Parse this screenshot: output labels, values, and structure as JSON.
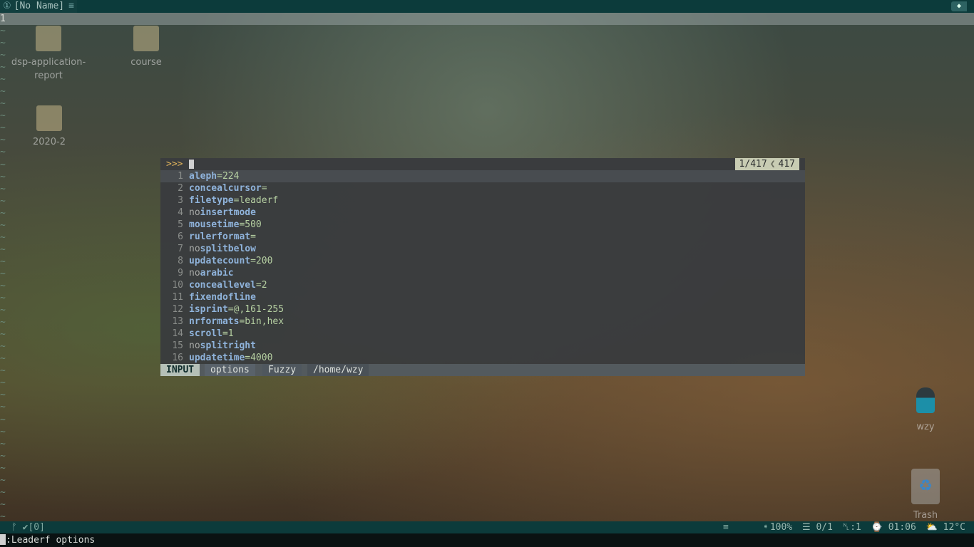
{
  "tabline": {
    "tab_number": "①",
    "tab_title": "[No Name]",
    "tab_icon": "≡"
  },
  "buffer": {
    "line_number": "1",
    "tilde": "~"
  },
  "desktop": {
    "icons": [
      {
        "label_line1": "dsp-application-",
        "label_line2": "report"
      },
      {
        "label_line1": "course",
        "label_line2": ""
      },
      {
        "label_line1": "2020-2",
        "label_line2": ""
      },
      {
        "label_line1": "wzy",
        "label_line2": ""
      },
      {
        "label_line1": "Trash",
        "label_line2": ""
      }
    ]
  },
  "leaderf": {
    "prompt": ">>>",
    "counter": "1/417",
    "total": "417",
    "rows": [
      {
        "n": "1",
        "prefix": "",
        "name": "aleph",
        "value": "=224"
      },
      {
        "n": "2",
        "prefix": "",
        "name": "concealcursor",
        "value": "="
      },
      {
        "n": "3",
        "prefix": "",
        "name": "filetype",
        "value": "=leaderf"
      },
      {
        "n": "4",
        "prefix": "no",
        "name": "insertmode",
        "value": ""
      },
      {
        "n": "5",
        "prefix": "",
        "name": "mousetime",
        "value": "=500"
      },
      {
        "n": "6",
        "prefix": "",
        "name": "rulerformat",
        "value": "="
      },
      {
        "n": "7",
        "prefix": "no",
        "name": "splitbelow",
        "value": ""
      },
      {
        "n": "8",
        "prefix": "",
        "name": "updatecount",
        "value": "=200"
      },
      {
        "n": "9",
        "prefix": "no",
        "name": "arabic",
        "value": ""
      },
      {
        "n": "10",
        "prefix": "",
        "name": "conceallevel",
        "value": "=2"
      },
      {
        "n": "11",
        "prefix": "",
        "name": "fixendofline",
        "value": ""
      },
      {
        "n": "12",
        "prefix": "",
        "name": "isprint",
        "value": "=@,161-255"
      },
      {
        "n": "13",
        "prefix": "",
        "name": "nrformats",
        "value": "=bin,hex"
      },
      {
        "n": "14",
        "prefix": "",
        "name": "scroll",
        "value": "=1"
      },
      {
        "n": "15",
        "prefix": "no",
        "name": "splitright",
        "value": ""
      },
      {
        "n": "16",
        "prefix": "",
        "name": "updatetime",
        "value": "=4000"
      }
    ],
    "status": {
      "mode": "INPUT",
      "category": "options",
      "match_mode": "Fuzzy",
      "cwd": "/home/wzy"
    }
  },
  "statusline": {
    "left": "ᚠ ✔[0]",
    "icon_left": "≡",
    "icon_mid": "➧",
    "zoom": "100%",
    "position": "☰ 0/1",
    "column": "␤:1",
    "time": "⌚ 01:06",
    "weather": "⛅ 12°C"
  },
  "cmdline": {
    "text": "Leaderf options"
  },
  "colors": {
    "accent": "#0c3b3b",
    "option_name": "#8fb3db",
    "option_value": "#b6d0a2",
    "prompt": "#e0b35b"
  }
}
